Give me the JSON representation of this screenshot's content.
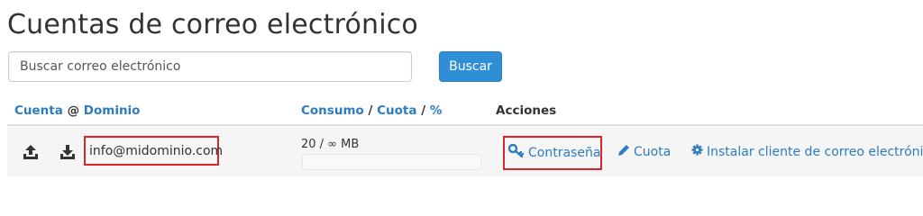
{
  "page": {
    "title": "Cuentas de correo electrónico"
  },
  "search": {
    "placeholder": "Buscar correo electrónico",
    "button_label": "Buscar"
  },
  "table": {
    "headers": {
      "account": "Cuenta",
      "at": "@",
      "domain": "Dominio",
      "usage": "Consumo",
      "slash1": "/",
      "quota": "Cuota",
      "slash2": "/",
      "percent": "%",
      "actions": "Acciones"
    },
    "rows": [
      {
        "email": "info@midominio.com",
        "usage_text": "20 / ∞ MB",
        "usage_fraction": 0,
        "actions": {
          "password": "Contraseña",
          "quota": "Cuota",
          "install_client": "Instalar cliente de correo electrónico"
        }
      }
    ]
  },
  "colors": {
    "link": "#2d7cbf",
    "button": "#2f8fd6",
    "highlight": "#d9252a",
    "row_bg": "#f5f5f5"
  },
  "icons": [
    "upload-icon",
    "download-icon",
    "key-icon",
    "pencil-icon",
    "gear-icon"
  ]
}
